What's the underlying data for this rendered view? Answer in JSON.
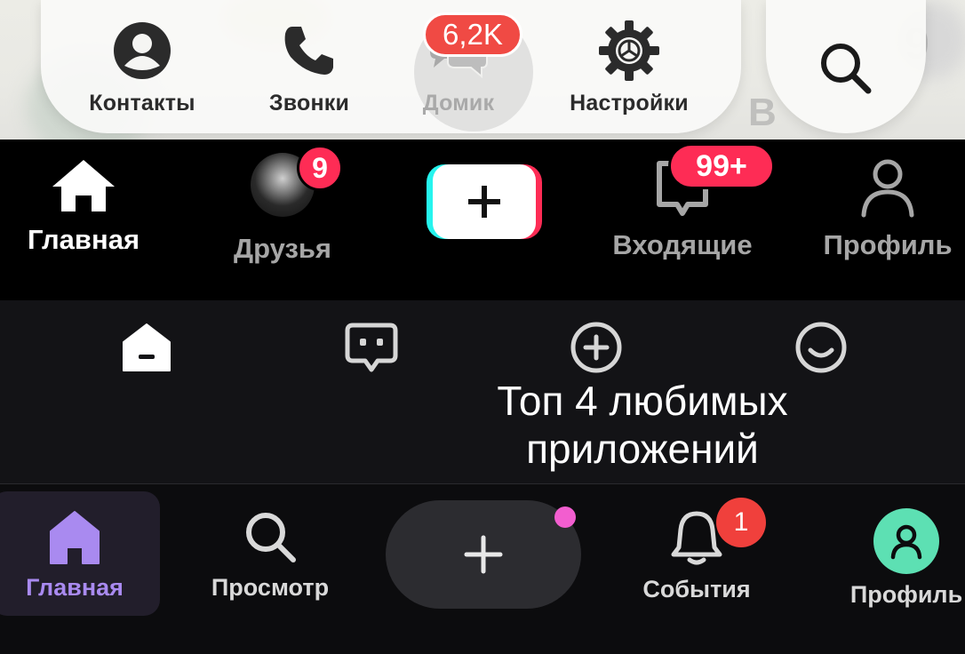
{
  "top_bar": {
    "badge": "6,2K",
    "items": [
      {
        "label": "Контакты",
        "icon": "person-circle-icon"
      },
      {
        "label": "Звонки",
        "icon": "phone-icon"
      },
      {
        "label": "Домик",
        "icon": "chat-bubbles-icon"
      },
      {
        "label": "Настройки",
        "icon": "gear-icon"
      }
    ],
    "search_icon": "search-icon",
    "background_text": [
      "9",
      "В"
    ]
  },
  "tiktok_bar": {
    "items": [
      {
        "label": "Главная",
        "icon": "home-icon"
      },
      {
        "label": "Друзья",
        "icon": "friend-avatar"
      },
      {
        "label": "",
        "icon": "create-plus-icon"
      },
      {
        "label": "Входящие",
        "icon": "inbox-icon"
      },
      {
        "label": "Профиль",
        "icon": "profile-icon"
      }
    ],
    "friends_badge": "9",
    "inbox_badge": "99+"
  },
  "icon_bar": {
    "icons": [
      "home-icon",
      "chat-bubble-icon",
      "add-circle-icon",
      "smile-icon"
    ]
  },
  "caption": {
    "line1": "Топ 4 любимых",
    "line2": "приложений"
  },
  "bottom_nav": {
    "items": [
      {
        "label": "Главная",
        "icon": "home-icon"
      },
      {
        "label": "Просмотр",
        "icon": "search-icon"
      },
      {
        "label": "",
        "icon": "plus-icon"
      },
      {
        "label": "События",
        "icon": "bell-icon"
      },
      {
        "label": "Профиль",
        "icon": "profile-icon"
      }
    ],
    "events_badge": "1",
    "accent_color": "#a98af0"
  }
}
